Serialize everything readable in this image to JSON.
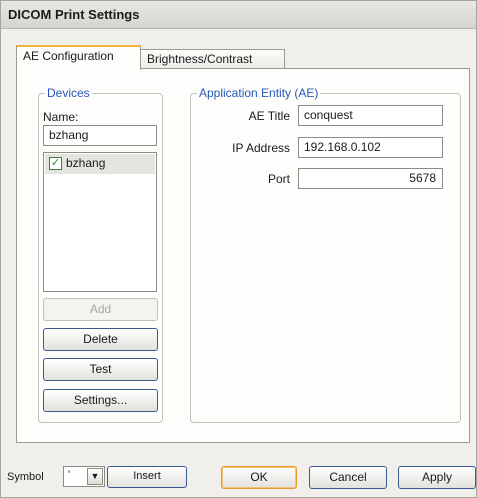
{
  "window": {
    "title": "DICOM Print Settings"
  },
  "tabs": [
    {
      "label": "AE Configuration",
      "active": true
    },
    {
      "label": "Brightness/Contrast",
      "active": false
    }
  ],
  "devices": {
    "legend": "Devices",
    "name_label": "Name:",
    "name_value": "bzhang",
    "list": [
      {
        "label": "bzhang",
        "checked": true
      }
    ],
    "buttons": {
      "add": "Add",
      "delete": "Delete",
      "test": "Test",
      "settings": "Settings..."
    }
  },
  "app_entity": {
    "legend": "Application Entity (AE)",
    "ae_title_label": "AE Title",
    "ae_title_value": "conquest",
    "ip_label": "IP Address",
    "ip_value": "192.168.0.102",
    "port_label": "Port",
    "port_value": "5678"
  },
  "footer": {
    "symbol_label": "Symbol",
    "symbol_value": "'",
    "insert": "Insert",
    "ok": "OK",
    "cancel": "Cancel",
    "apply": "Apply"
  },
  "icons": {
    "check": "checkmark-icon",
    "dropdown": "chevron-down-icon"
  }
}
